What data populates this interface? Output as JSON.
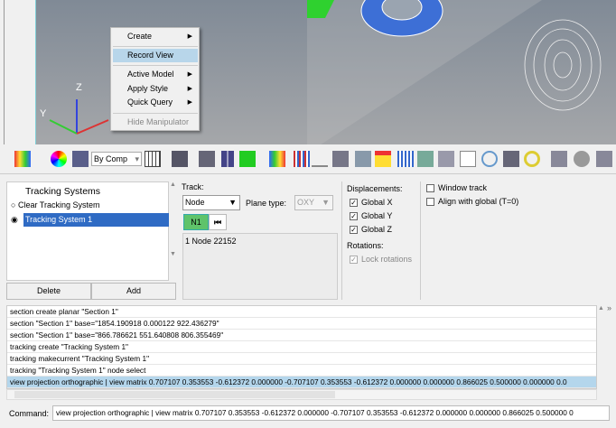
{
  "context_menu": {
    "items": [
      {
        "label": "Create",
        "submenu": true
      },
      {
        "label": "Record View",
        "highlighted": true
      },
      {
        "label": "Active Model",
        "submenu": true
      },
      {
        "label": "Apply Style",
        "submenu": true
      },
      {
        "label": "Quick Query",
        "submenu": true
      },
      {
        "label": "Hide Manipulator",
        "disabled": true
      }
    ]
  },
  "triad": {
    "z": "Z",
    "y": "Y"
  },
  "toolbar": {
    "color_mode": "By Comp"
  },
  "tracking": {
    "title": "Tracking Systems",
    "items": [
      {
        "label": "Clear Tracking System",
        "selected": false
      },
      {
        "label": "Tracking System 1",
        "selected": true
      }
    ],
    "delete_label": "Delete",
    "add_label": "Add",
    "track_label": "Track:",
    "track_value": "Node",
    "plane_type_label": "Plane type:",
    "plane_type_value": "OXY",
    "n1_label": "N1",
    "selection": "1 Node 22152",
    "displacements_label": "Displacements:",
    "global_x": "Global X",
    "global_y": "Global Y",
    "global_z": "Global Z",
    "rotations_label": "Rotations:",
    "lock_rotations": "Lock rotations",
    "window_track": "Window track",
    "align_global": "Align with global (T=0)"
  },
  "history": [
    "section create planar \"Section 1\"",
    "section \"Section 1\" base=\"1854.190918 0.000122 922.436279\"",
    "section \"Section 1\" base=\"866.786621 551.640808 806.355469\"",
    "tracking create \"Tracking System 1\"",
    "tracking makecurrent \"Tracking System 1\"",
    "tracking \"Tracking System 1\" node select",
    "view projection orthographic | view matrix 0.707107 0.353553 -0.612372 0.000000 -0.707107 0.353553 -0.612372 0.000000 0.000000 0.866025 0.500000 0.000000 0.0"
  ],
  "command": {
    "label": "Command:",
    "value": "view projection orthographic | view matrix 0.707107 0.353553 -0.612372 0.000000 -0.707107 0.353553 -0.612372 0.000000 0.000000 0.866025 0.500000 0"
  },
  "colors": {
    "selection": "#2f6bc4",
    "menu_highlight": "#b8d6ea",
    "n1_button": "#5fc36a"
  }
}
